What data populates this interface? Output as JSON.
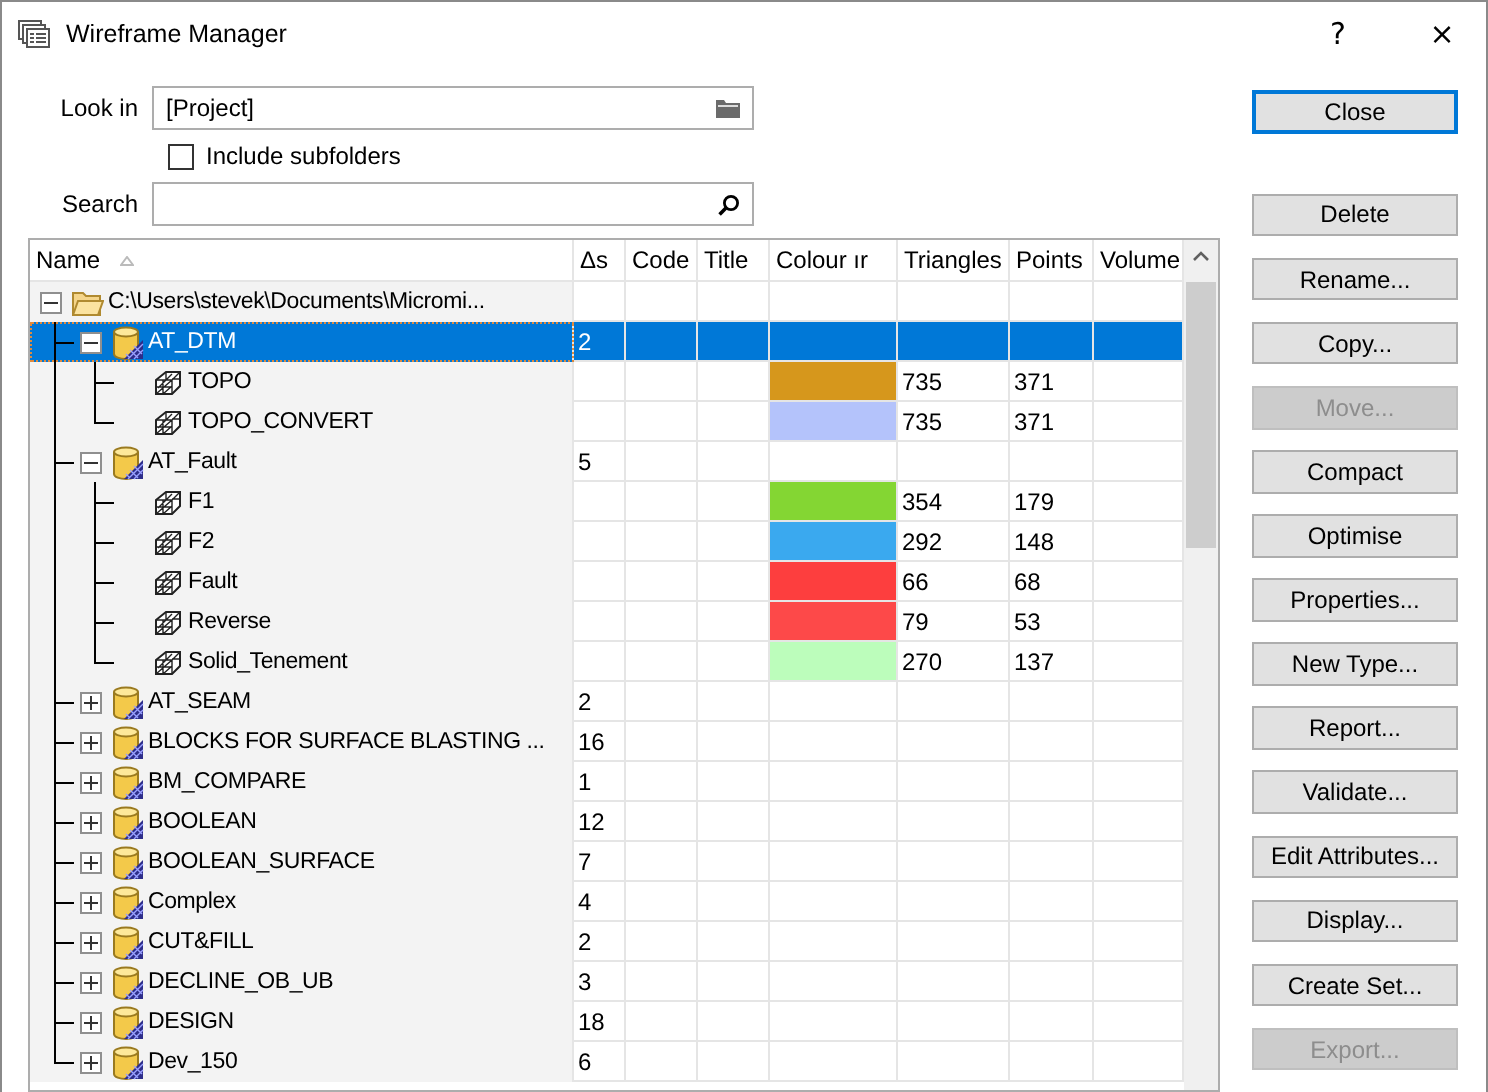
{
  "window": {
    "title": "Wireframe Manager",
    "help": "?",
    "close": "×"
  },
  "look_in": {
    "label": "Look in",
    "value": "[Project]"
  },
  "include_subfolders": {
    "label": "Include subfolders",
    "checked": false
  },
  "search": {
    "label": "Search"
  },
  "table": {
    "columns": [
      "Name",
      "Δs",
      "Code",
      "Title",
      "Colour ır",
      "Triangles",
      "Points",
      "Volume"
    ],
    "rows": [
      {
        "kind": "folder",
        "name": "C:\\Users\\stevek\\Documents\\Micromi...",
        "expanded": true,
        "selected": false,
        "children": [
          {
            "kind": "database",
            "name": "AT_DTM",
            "delta": "2",
            "expanded": true,
            "selected": true,
            "children": [
              {
                "kind": "wireframe",
                "name": "TOPO",
                "color": "#d6971c",
                "triangles": "735",
                "points": "371",
                "selected": false
              },
              {
                "kind": "wireframe",
                "name": "TOPO_CONVERT",
                "color": "#b4c3fb",
                "triangles": "735",
                "points": "371",
                "selected": false
              }
            ]
          },
          {
            "kind": "database",
            "name": "AT_Fault",
            "delta": "5",
            "expanded": true,
            "selected": false,
            "children": [
              {
                "kind": "wireframe",
                "name": "F1",
                "color": "#84d633",
                "triangles": "354",
                "points": "179",
                "selected": false
              },
              {
                "kind": "wireframe",
                "name": "F2",
                "color": "#3aa9ef",
                "triangles": "292",
                "points": "148",
                "selected": false
              },
              {
                "kind": "wireframe",
                "name": "Fault",
                "color": "#fd3e3e",
                "triangles": "66",
                "points": "68",
                "selected": false
              },
              {
                "kind": "wireframe",
                "name": "Reverse",
                "color": "#fd4949",
                "triangles": "79",
                "points": "53",
                "selected": false
              },
              {
                "kind": "wireframe",
                "name": "Solid_Tenement",
                "color": "#bcfdbb",
                "triangles": "270",
                "points": "137",
                "selected": false
              }
            ]
          },
          {
            "kind": "database",
            "name": "AT_SEAM",
            "delta": "2",
            "expanded": false,
            "selected": false
          },
          {
            "kind": "database",
            "name": "BLOCKS FOR SURFACE BLASTING ...",
            "delta": "16",
            "expanded": false,
            "selected": false
          },
          {
            "kind": "database",
            "name": "BM_COMPARE",
            "delta": "1",
            "expanded": false,
            "selected": false
          },
          {
            "kind": "database",
            "name": "BOOLEAN",
            "delta": "12",
            "expanded": false,
            "selected": false
          },
          {
            "kind": "database",
            "name": "BOOLEAN_SURFACE",
            "delta": "7",
            "expanded": false,
            "selected": false
          },
          {
            "kind": "database",
            "name": "Complex",
            "delta": "4",
            "expanded": false,
            "selected": false
          },
          {
            "kind": "database",
            "name": "CUT&FILL",
            "delta": "2",
            "expanded": false,
            "selected": false
          },
          {
            "kind": "database",
            "name": "DECLINE_OB_UB",
            "delta": "3",
            "expanded": false,
            "selected": false
          },
          {
            "kind": "database",
            "name": "DESIGN",
            "delta": "18",
            "expanded": false,
            "selected": false
          },
          {
            "kind": "database",
            "name": "Dev_150",
            "delta": "6",
            "expanded": false,
            "selected": false
          }
        ]
      }
    ]
  },
  "buttons": [
    {
      "label": "Close",
      "default": true,
      "disabled": false
    },
    {
      "label": "Delete",
      "default": false,
      "disabled": false
    },
    {
      "label": "Rename...",
      "default": false,
      "disabled": false
    },
    {
      "label": "Copy...",
      "default": false,
      "disabled": false
    },
    {
      "label": "Move...",
      "default": false,
      "disabled": true
    },
    {
      "label": "Compact",
      "default": false,
      "disabled": false
    },
    {
      "label": "Optimise",
      "default": false,
      "disabled": false
    },
    {
      "label": "Properties...",
      "default": false,
      "disabled": false
    },
    {
      "label": "New Type...",
      "default": false,
      "disabled": false
    },
    {
      "label": "Report...",
      "default": false,
      "disabled": false
    },
    {
      "label": "Validate...",
      "default": false,
      "disabled": false
    },
    {
      "label": "Edit Attributes...",
      "default": false,
      "disabled": false
    },
    {
      "label": "Display...",
      "default": false,
      "disabled": false
    },
    {
      "label": "Create Set...",
      "default": false,
      "disabled": false
    },
    {
      "label": "Export...",
      "default": false,
      "disabled": true
    }
  ]
}
